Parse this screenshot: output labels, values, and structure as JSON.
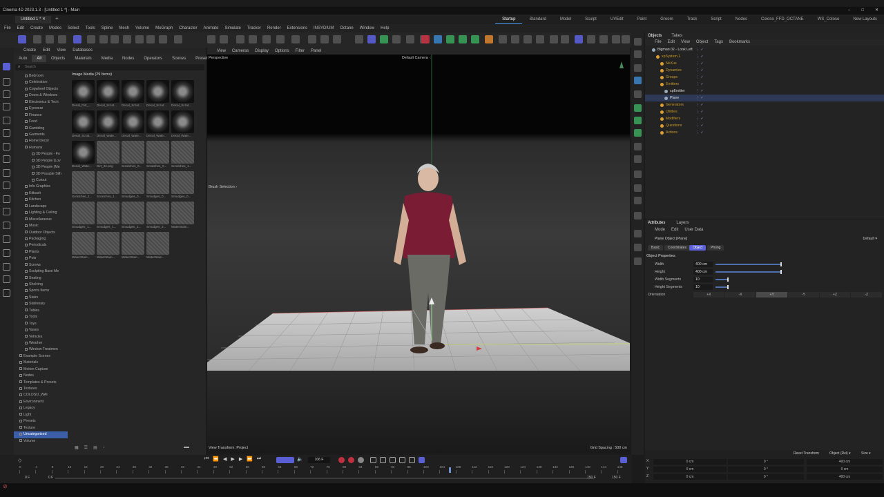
{
  "window": {
    "title": "Cinema 4D 2023.1.3 - [Untitled 1 *] - Main",
    "doc_tab": "Untitled 1 *"
  },
  "layouts": [
    "Startup",
    "Standard",
    "Model",
    "Sculpt",
    "UVEdit",
    "Paint",
    "Groom",
    "Track",
    "Script",
    "Nodes",
    "Coloso_FFD_OCTANE",
    "WS_Coloso",
    "New Layouts"
  ],
  "menu": [
    "File",
    "Edit",
    "Create",
    "Modes",
    "Select",
    "Tools",
    "Spline",
    "Mesh",
    "Volume",
    "MoGraph",
    "Character",
    "Animate",
    "Simulate",
    "Tracker",
    "Render",
    "Extensions",
    "INSYDIUM",
    "Octane",
    "Window",
    "Help"
  ],
  "asset_browser": {
    "menu": [
      "Create",
      "Edit",
      "View",
      "Databases"
    ],
    "tabs": [
      "Auto",
      "All",
      "Objects",
      "Materials",
      "Media",
      "Nodes",
      "Operators",
      "Scenes",
      "Presets"
    ],
    "active_tab": "All",
    "search_placeholder": "Search",
    "gallery_title": "Image Media (29 Items)",
    "tree": [
      "Bedroom",
      "Celebration",
      "Cogwheel Objects",
      "Doors & Windows",
      "Electronics & Tech",
      "Eyewear",
      "Finance",
      "Food",
      "Gambling",
      "Garments",
      "Home Decor",
      "Humans",
      "3D People - Fo",
      "3D People (Lov",
      "3D People (Me",
      "3D Posable Silh",
      "Cutout",
      "Info Graphics",
      "Kitbash",
      "Kitchen",
      "Landscape",
      "Lighting & Ceiling",
      "Miscellaneous",
      "Music",
      "Outdoor Objects",
      "Packaging",
      "Periodicals",
      "Plants",
      "Pots",
      "Screws",
      "Sculpting Base Me",
      "Seating",
      "Shelving",
      "Sports Items",
      "Stairs",
      "Stationary",
      "Tables",
      "Tools",
      "Toys",
      "Vases",
      "Vehicles",
      "Weather",
      "Window Treatmen",
      "Example Scenes",
      "Materials",
      "Motion Capture",
      "Nodes",
      "Templates & Presets",
      "Textures",
      "COLOSO_WAI",
      "Environment",
      "Legacy",
      "Light",
      "Presets",
      "Texture",
      "Uncategorized",
      "Volume"
    ],
    "selected_tree_item": "Uncategorized",
    "thumbs": [
      {
        "label": "Decal_Dirt_...",
        "style": "dark"
      },
      {
        "label": "Decal_Scrat...",
        "style": "dark"
      },
      {
        "label": "Decal_Scrat...",
        "style": "dark"
      },
      {
        "label": "Decal_Scrat...",
        "style": "dark"
      },
      {
        "label": "Decal_Scrat...",
        "style": "dark"
      },
      {
        "label": "Decal_Scrat...",
        "style": "dark"
      },
      {
        "label": "Decal_Wate...",
        "style": "dark"
      },
      {
        "label": "Decal_Wate...",
        "style": "dark"
      },
      {
        "label": "Decal_Wate...",
        "style": "dark"
      },
      {
        "label": "Decal_Wate...",
        "style": "dark"
      },
      {
        "label": "Decal_Wate...",
        "style": "dark"
      },
      {
        "label": "Dirt_02.png",
        "style": "gray"
      },
      {
        "label": "Scratches_0...",
        "style": "gray"
      },
      {
        "label": "Scratches_0...",
        "style": "gray"
      },
      {
        "label": "Scratches_1...",
        "style": "gray"
      },
      {
        "label": "Scratches_1...",
        "style": "gray"
      },
      {
        "label": "Scratches_1...",
        "style": "gray"
      },
      {
        "label": "Smudges_0...",
        "style": "gray"
      },
      {
        "label": "Smudges_0...",
        "style": "gray"
      },
      {
        "label": "Smudges_0...",
        "style": "gray"
      },
      {
        "label": "Smudges_1...",
        "style": "gray"
      },
      {
        "label": "Smudges_1...",
        "style": "gray"
      },
      {
        "label": "Smudges_2...",
        "style": "gray"
      },
      {
        "label": "Smudges_2...",
        "style": "gray"
      },
      {
        "label": "WaterStain...",
        "style": "gray"
      },
      {
        "label": "WaterStain...",
        "style": "gray"
      },
      {
        "label": "WaterStain...",
        "style": "gray"
      },
      {
        "label": "WaterStain...",
        "style": "gray"
      },
      {
        "label": "WaterStain...",
        "style": "gray"
      }
    ]
  },
  "viewport": {
    "menu": [
      "View",
      "Cameras",
      "Display",
      "Options",
      "Filter",
      "Panel"
    ],
    "label": "Perspective",
    "camera": "Default Camera",
    "brush_selection": "Brush Selection",
    "view_transform": "View Transform: Project",
    "grid_spacing": "Grid Spacing : 500 cm"
  },
  "objects": {
    "tabs": [
      "Objects",
      "Takes"
    ],
    "menu": [
      "File",
      "Edit",
      "View",
      "Object",
      "Tags",
      "Bookmarks"
    ],
    "items": [
      {
        "name": "Bigman 02 - Look Left",
        "white": true
      },
      {
        "name": "xpSystem.1",
        "white": false
      },
      {
        "name": "NeXus",
        "white": false
      },
      {
        "name": "Dynamics",
        "white": false
      },
      {
        "name": "Groups",
        "white": false
      },
      {
        "name": "Emitters",
        "white": false
      },
      {
        "name": "xpEmitter",
        "white": true
      },
      {
        "name": "Plane",
        "white": true
      },
      {
        "name": "Generators",
        "white": false
      },
      {
        "name": "Utilities",
        "white": false
      },
      {
        "name": "Modifiers",
        "white": false
      },
      {
        "name": "Questions",
        "white": false
      },
      {
        "name": "Actions",
        "white": false
      }
    ]
  },
  "attributes": {
    "tabs": [
      "Attributes",
      "Layers"
    ],
    "menu": [
      "Mode",
      "Edit",
      "User Data"
    ],
    "title": "Plane Object [Plane]",
    "preset": "Default",
    "subtabs": [
      "Basic",
      "Coordinates",
      "Object",
      "Phong"
    ],
    "active_subtab": "Object",
    "section": "Object Properties",
    "rows": [
      {
        "label": "Width",
        "value": "400 cm",
        "fill": 1.0
      },
      {
        "label": "Height",
        "value": "400 cm",
        "fill": 1.0
      },
      {
        "label": "Width Segments",
        "value": "10",
        "fill": 0.2
      },
      {
        "label": "Height Segments",
        "value": "10",
        "fill": 0.2
      }
    ],
    "orientation_label": "Orientation",
    "orientation": [
      "+X",
      "-X",
      "+Y",
      "-Y",
      "+Z",
      "-Z"
    ],
    "orientation_active": "+Y"
  },
  "timeline": {
    "ticks": [
      "0",
      "4",
      "8",
      "12",
      "16",
      "20",
      "24",
      "28",
      "32",
      "36",
      "40",
      "44",
      "48",
      "52",
      "56",
      "60",
      "64",
      "68",
      "72",
      "76",
      "80",
      "84",
      "88",
      "92",
      "96",
      "100",
      "104",
      "108",
      "112",
      "116",
      "120",
      "124",
      "128",
      "132",
      "136",
      "140",
      "144",
      "148"
    ],
    "current_frame": "106 F",
    "start": "0 F",
    "start2": "0 F",
    "end": "150 F",
    "end2": "150 F"
  },
  "coords": {
    "reset": "Reset Transform",
    "mode": "Object (Rel)",
    "size_mode": "Size",
    "rows": [
      {
        "axis": "X",
        "pos": "0 cm",
        "rot": "0 °",
        "size": "400 cm"
      },
      {
        "axis": "Y",
        "pos": "0 cm",
        "rot": "0 °",
        "size": "0 cm"
      },
      {
        "axis": "Z",
        "pos": "0 cm",
        "rot": "0 °",
        "size": "400 cm"
      }
    ]
  }
}
